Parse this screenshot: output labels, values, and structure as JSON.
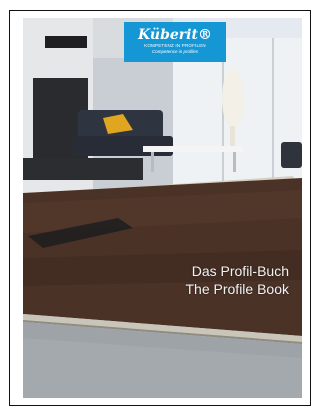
{
  "brand": {
    "name": "Küberit®",
    "tagline": "Kompetenz in Profilen",
    "tagline_en": "Competence in profiles",
    "color": "#1597d6"
  },
  "title": {
    "de": "Das Profil-Buch",
    "en": "The Profile Book"
  }
}
